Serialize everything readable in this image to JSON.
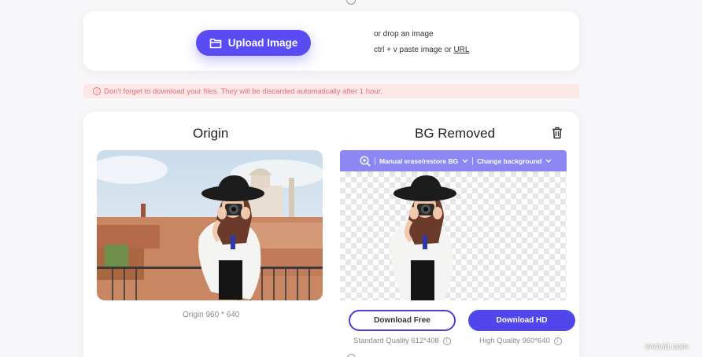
{
  "upload": {
    "button_label": "Upload Image",
    "drop_hint": "or drop an image",
    "paste_hint_prefix": "ctrl + v paste image or ",
    "paste_hint_link": "URL"
  },
  "warning": {
    "message": "Don't forget to download your files. They will be discarded automatically after 1 hour."
  },
  "result": {
    "origin_title": "Origin",
    "removed_title": "BG Removed",
    "origin_caption": "Origin 960 * 640",
    "toolbar": {
      "erase_label": "Manual erase/restore BG",
      "background_label": "Change background"
    },
    "download_free_label": "Download Free",
    "download_hd_label": "Download HD",
    "standard_quality": "Standard Quality 612*408",
    "high_quality": "High Quality 960*640"
  },
  "watermark": "wvtvid.com",
  "colors": {
    "accent": "#5a4cf5",
    "toolbar": "#8c87f3",
    "warning_bg": "#fde8e8",
    "warning_text": "#e4707a"
  }
}
